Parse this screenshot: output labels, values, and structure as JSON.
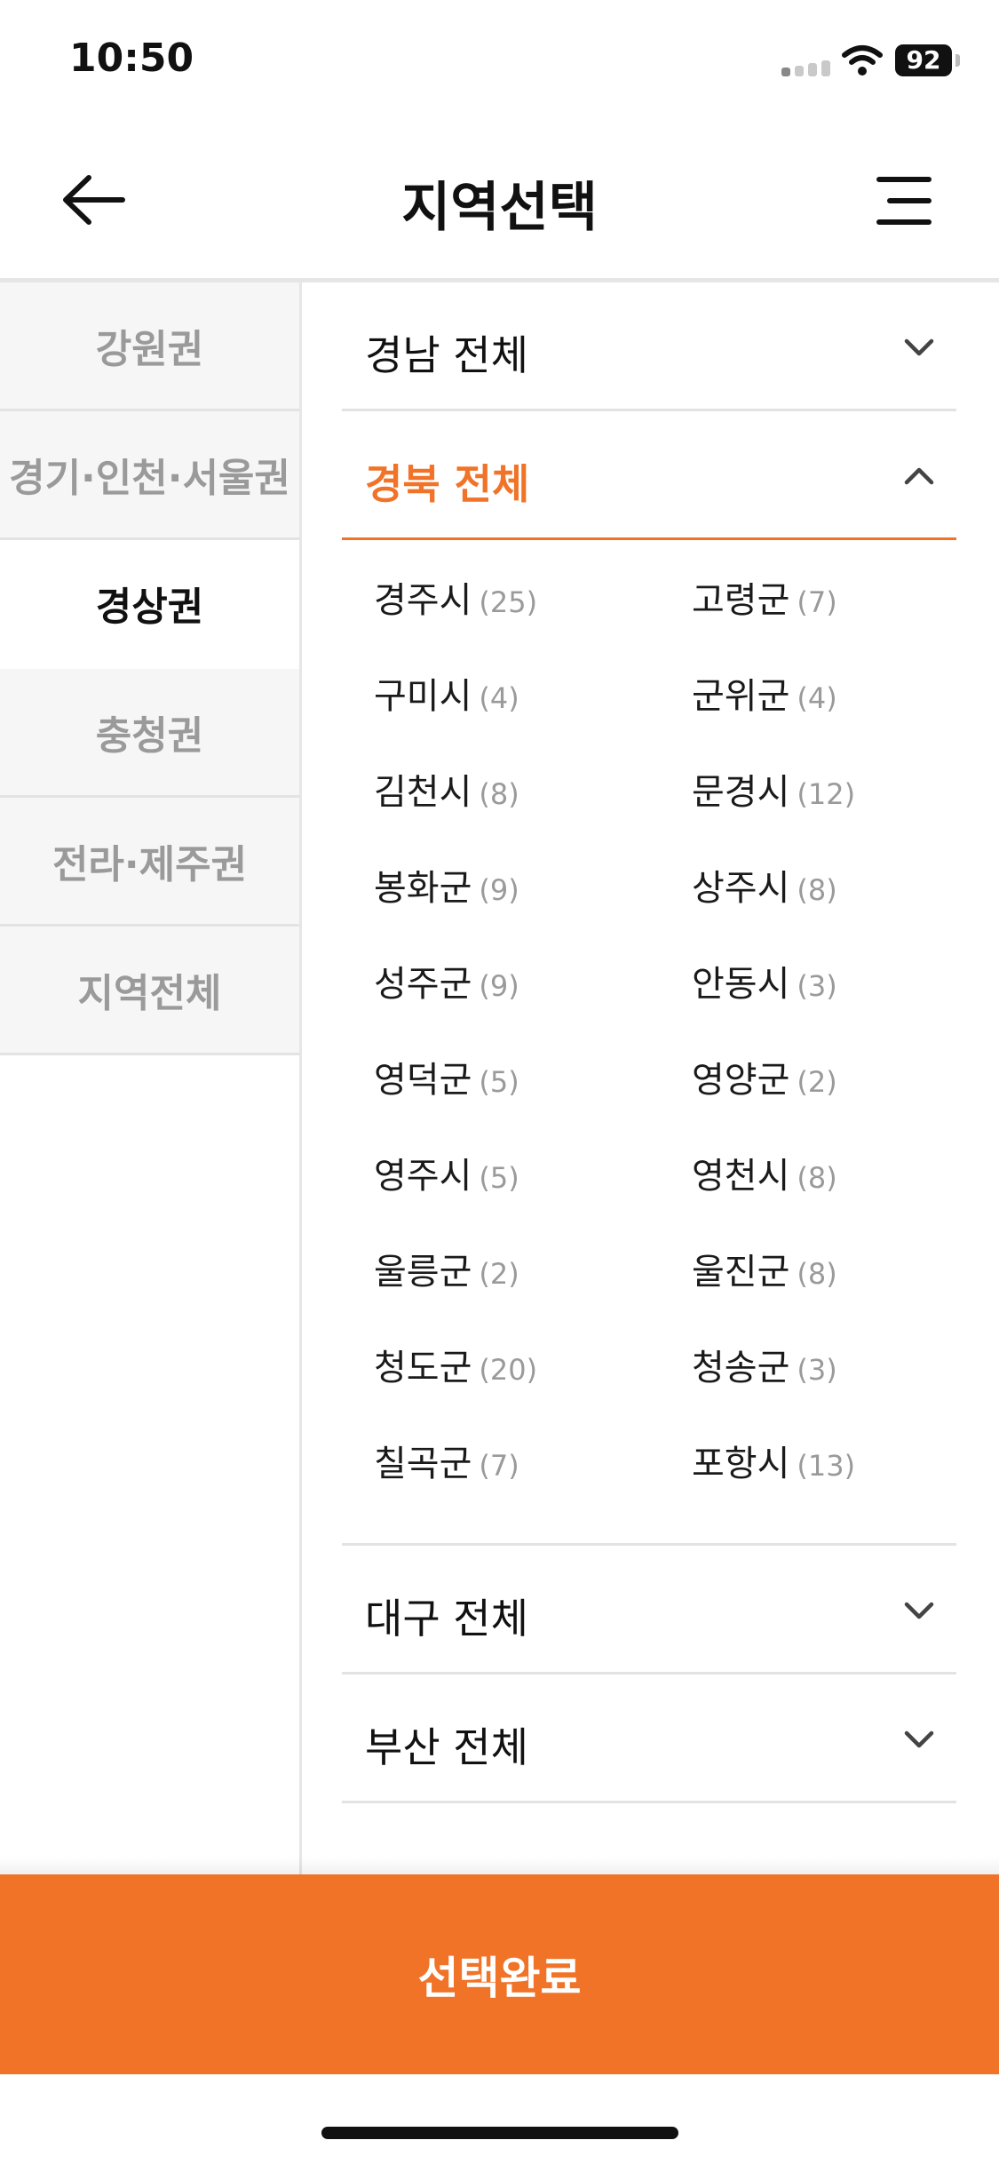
{
  "status_bar": {
    "time": "10:50",
    "battery": "92"
  },
  "header": {
    "title": "지역선택",
    "back_icon": "arrow-left-icon",
    "menu_icon": "menu-icon"
  },
  "sidebar": {
    "items": [
      {
        "label": "강원권",
        "active": false
      },
      {
        "label": "경기·인천·서울권",
        "active": false
      },
      {
        "label": "경상권",
        "active": true
      },
      {
        "label": "충청권",
        "active": false
      },
      {
        "label": "전라·제주권",
        "active": false
      },
      {
        "label": "지역전체",
        "active": false
      }
    ]
  },
  "regions": [
    {
      "label": "경남 전체",
      "open": false
    },
    {
      "label": "경북 전체",
      "open": true,
      "cities": [
        {
          "name": "경주시",
          "count": "(25)"
        },
        {
          "name": "고령군",
          "count": "(7)"
        },
        {
          "name": "구미시",
          "count": "(4)"
        },
        {
          "name": "군위군",
          "count": "(4)"
        },
        {
          "name": "김천시",
          "count": "(8)"
        },
        {
          "name": "문경시",
          "count": "(12)"
        },
        {
          "name": "봉화군",
          "count": "(9)"
        },
        {
          "name": "상주시",
          "count": "(8)"
        },
        {
          "name": "성주군",
          "count": "(9)"
        },
        {
          "name": "안동시",
          "count": "(3)"
        },
        {
          "name": "영덕군",
          "count": "(5)"
        },
        {
          "name": "영양군",
          "count": "(2)"
        },
        {
          "name": "영주시",
          "count": "(5)"
        },
        {
          "name": "영천시",
          "count": "(8)"
        },
        {
          "name": "울릉군",
          "count": "(2)"
        },
        {
          "name": "울진군",
          "count": "(8)"
        },
        {
          "name": "청도군",
          "count": "(20)"
        },
        {
          "name": "청송군",
          "count": "(3)"
        },
        {
          "name": "칠곡군",
          "count": "(7)"
        },
        {
          "name": "포항시",
          "count": "(13)"
        }
      ]
    },
    {
      "label": "대구 전체",
      "open": false
    },
    {
      "label": "부산 전체",
      "open": false
    }
  ],
  "confirm_label": "선택완료",
  "colors": {
    "accent": "#f07328",
    "muted": "#9a9a9a",
    "divider": "#e3e3e3"
  }
}
